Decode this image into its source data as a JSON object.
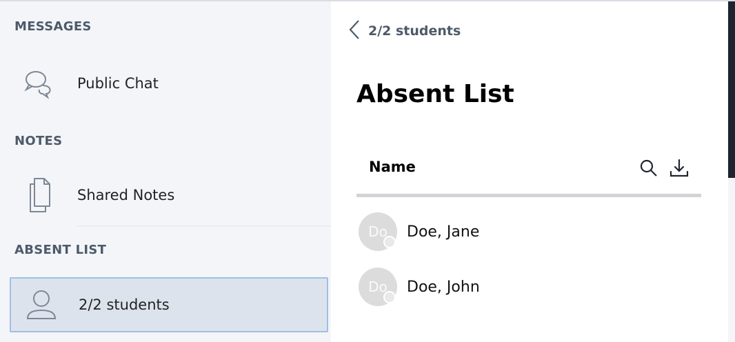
{
  "sidebar": {
    "sections": {
      "messages": "MESSAGES",
      "notes": "NOTES",
      "absent_list": "ABSENT LIST"
    },
    "items": [
      {
        "label": "Public Chat",
        "icon": "chat-bubbles-icon"
      },
      {
        "label": "Shared Notes",
        "icon": "documents-icon"
      },
      {
        "label": "2/2 students",
        "icon": "user-icon",
        "active": true
      }
    ]
  },
  "main": {
    "back_label": "2/2 students",
    "title": "Absent List",
    "table": {
      "column_name": "Name",
      "rows": [
        {
          "initials": "Do",
          "name": "Doe, Jane"
        },
        {
          "initials": "Do",
          "name": "Doe, John"
        }
      ]
    }
  },
  "colors": {
    "sidebar_bg": "#f3f5f9",
    "active_bg": "#dde3ec",
    "active_border": "#9ebfe6",
    "avatar_bg": "#dcdcdc"
  }
}
